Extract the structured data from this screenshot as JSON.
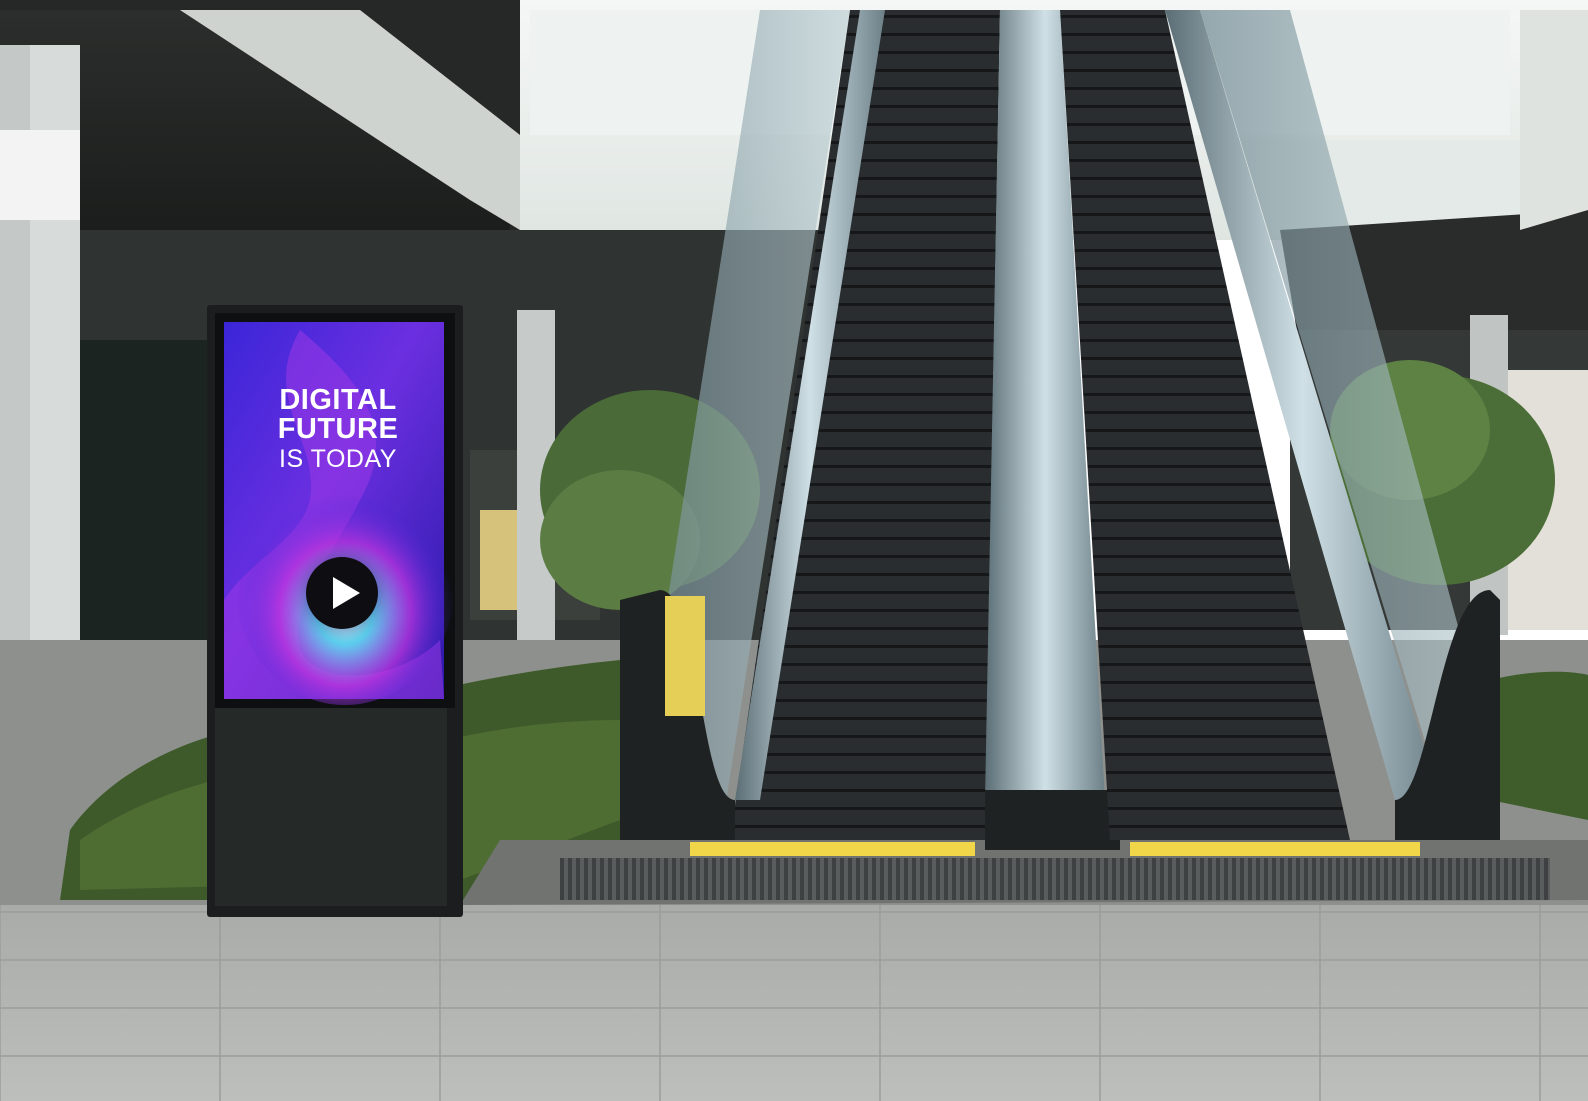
{
  "signage": {
    "headline_line1": "DIGITAL",
    "headline_line2": "FUTURE",
    "headline_line3": "IS TODAY"
  },
  "icons": {
    "play": "play-button-icon"
  },
  "colors": {
    "screen_blue": "#3b1fd6",
    "screen_purple": "#8a2be2",
    "screen_cyan": "#30d8f0",
    "safety_yellow": "#f2d64a"
  }
}
